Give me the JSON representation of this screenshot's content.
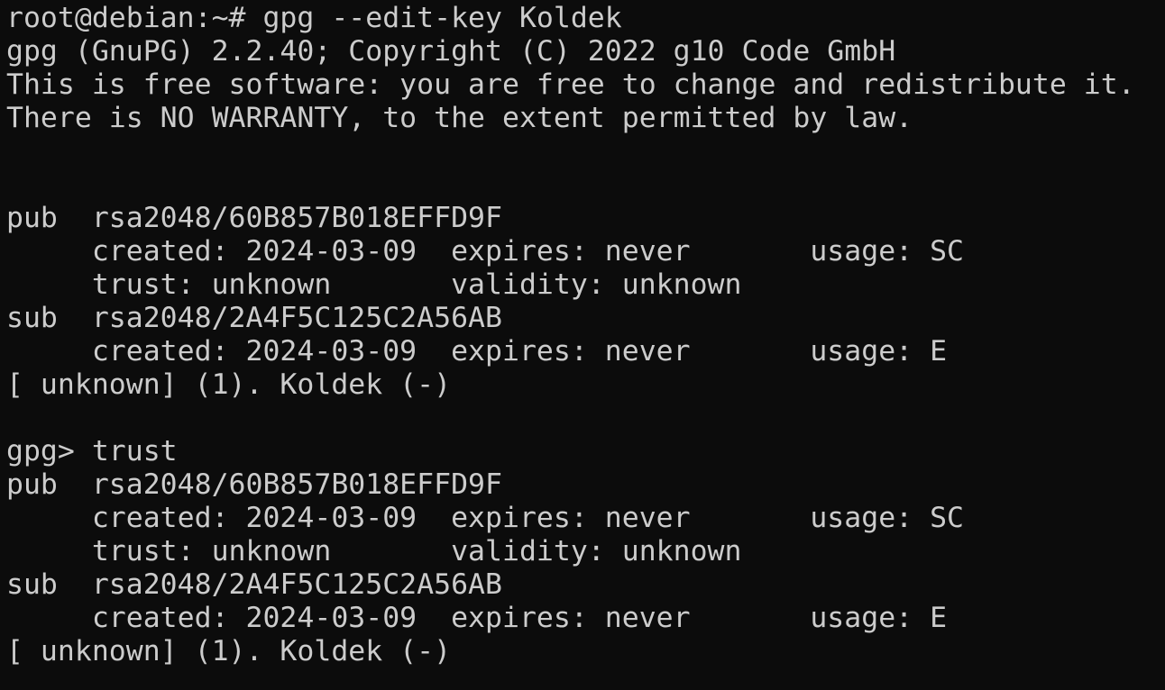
{
  "colors": {
    "background": "#0c0c0c",
    "foreground": "#cccccc"
  },
  "terminal": {
    "lines": [
      "root@debian:~# gpg --edit-key Koldek",
      "gpg (GnuPG) 2.2.40; Copyright (C) 2022 g10 Code GmbH",
      "This is free software: you are free to change and redistribute it.",
      "There is NO WARRANTY, to the extent permitted by law.",
      "",
      "",
      "pub  rsa2048/60B857B018EFFD9F",
      "     created: 2024-03-09  expires: never       usage: SC",
      "     trust: unknown       validity: unknown",
      "sub  rsa2048/2A4F5C125C2A56AB",
      "     created: 2024-03-09  expires: never       usage: E",
      "[ unknown] (1). Koldek (-)",
      "",
      "gpg> trust",
      "pub  rsa2048/60B857B018EFFD9F",
      "     created: 2024-03-09  expires: never       usage: SC",
      "     trust: unknown       validity: unknown",
      "sub  rsa2048/2A4F5C125C2A56AB",
      "     created: 2024-03-09  expires: never       usage: E",
      "[ unknown] (1). Koldek (-)"
    ]
  }
}
